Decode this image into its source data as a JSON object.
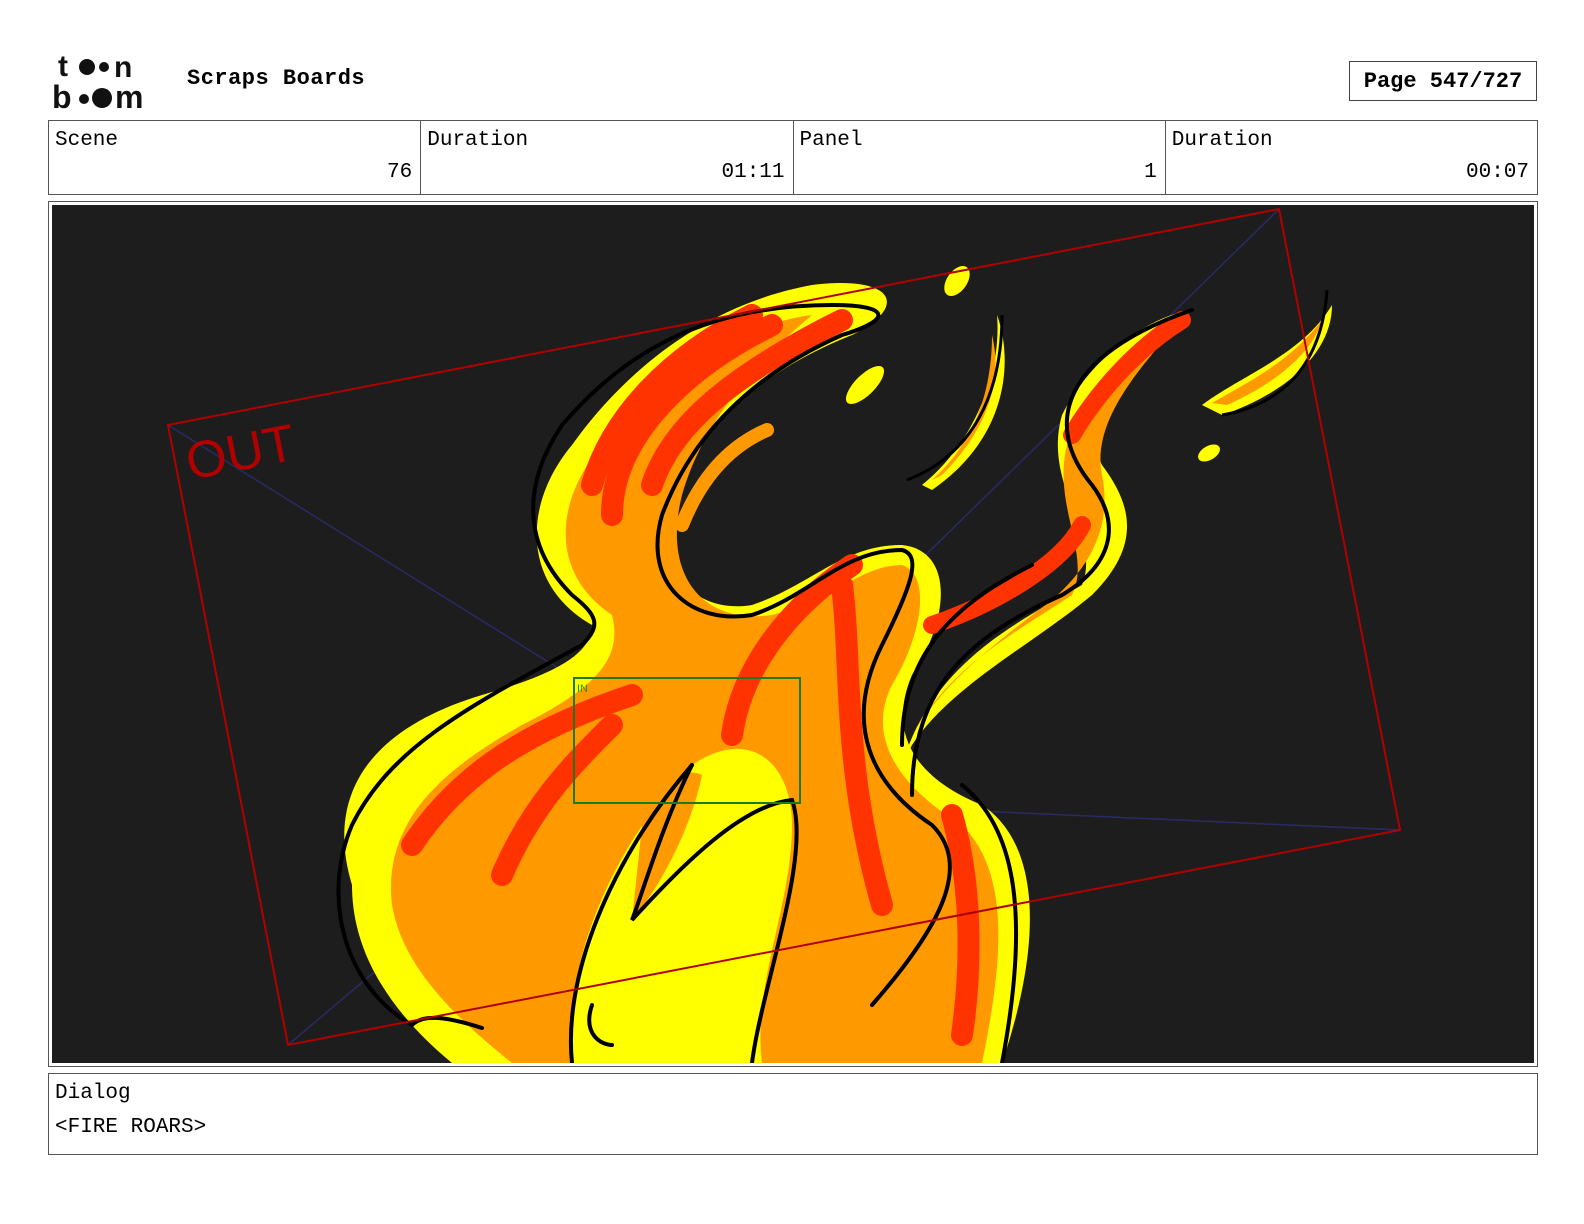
{
  "header": {
    "logo_text": "toon boom",
    "project_title": "Scraps Boards",
    "page_label": "Page 547/727"
  },
  "info": [
    {
      "label": "Scene",
      "value": "76"
    },
    {
      "label": "Duration",
      "value": "01:11"
    },
    {
      "label": "Panel",
      "value": "1"
    },
    {
      "label": "Duration",
      "value": "00:07"
    }
  ],
  "panel": {
    "out_label": "OUT",
    "in_label": "IN",
    "colors": {
      "background": "#1d1d1d",
      "flame_yellow": "#ffff00",
      "flame_orange": "#ff9900",
      "flame_red": "#ff3300",
      "out_frame": "#b00000",
      "in_frame": "#1f7a1f"
    }
  },
  "dialog": {
    "label": "Dialog",
    "text": "<FIRE ROARS>"
  }
}
